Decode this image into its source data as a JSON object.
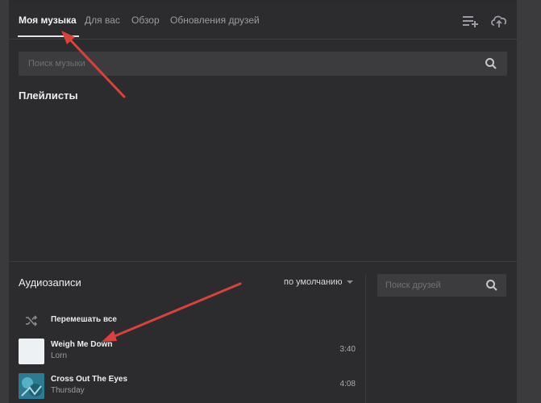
{
  "tabs": {
    "my_music": "Моя музыка",
    "for_you": "Для вас",
    "overview": "Обзор",
    "friends_updates": "Обновления друзей"
  },
  "header_icons": {
    "add_playlist": "playlist-add-icon",
    "upload": "cloud-upload-icon"
  },
  "search": {
    "placeholder": "Поиск музыки",
    "icon": "search-icon"
  },
  "playlists": {
    "title": "Плейлисты"
  },
  "audio": {
    "title": "Аудиозаписи",
    "sort_label": "по умолчанию",
    "shuffle_label": "Перемешать все",
    "tracks": [
      {
        "title": "Weigh Me Down",
        "artist": "Lorn",
        "duration": "3:40"
      },
      {
        "title": "Cross Out The Eyes",
        "artist": "Thursday",
        "duration": "4:08"
      }
    ]
  },
  "friends": {
    "placeholder": "Поиск друзей",
    "icon": "search-icon"
  },
  "colors": {
    "background": "#2b2b2d",
    "panel": "#2c2c2e",
    "field": "#3c3c3e",
    "annotation_arrow": "#d9413a"
  }
}
